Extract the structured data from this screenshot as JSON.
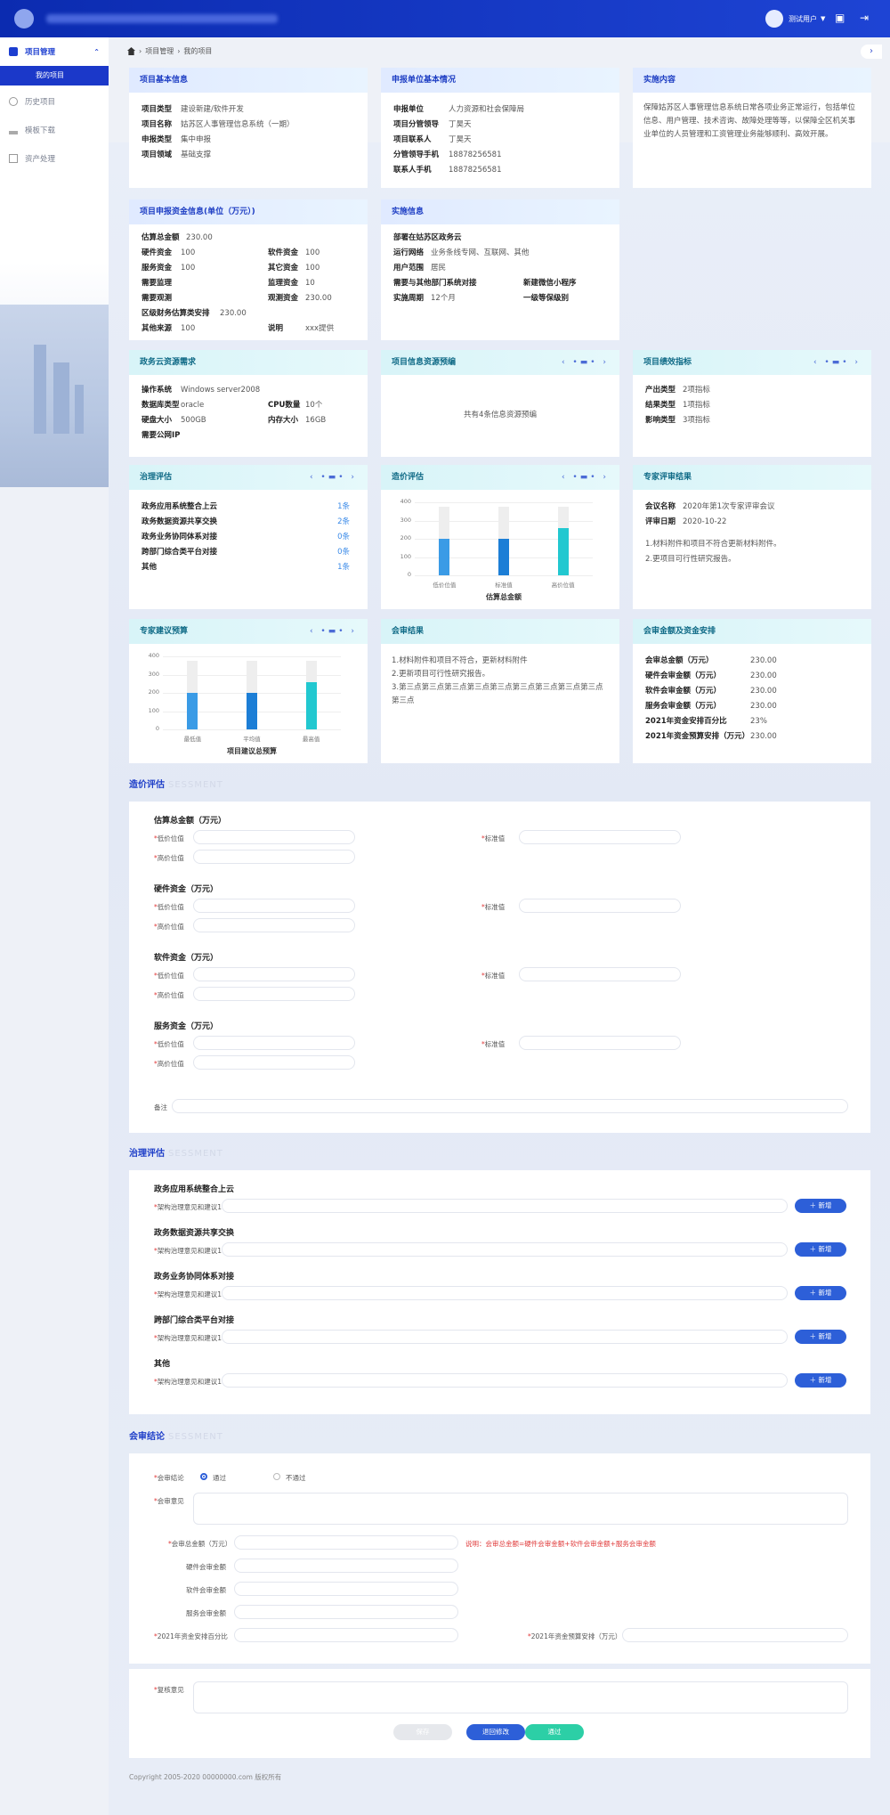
{
  "header": {
    "user": "测试用户"
  },
  "sidebar": {
    "items": [
      {
        "label": "项目管理"
      },
      {
        "label": "我的项目"
      },
      {
        "label": "历史项目"
      },
      {
        "label": "模板下载"
      },
      {
        "label": "资产处理"
      }
    ]
  },
  "breadcrumb": {
    "a": "项目管理",
    "b": "我的项目"
  },
  "basic": {
    "title": "项目基本信息",
    "rows": [
      [
        "项目类型",
        "建设新建/软件开发"
      ],
      [
        "项目名称",
        "姑苏区人事管理信息系统（一期）"
      ],
      [
        "申报类型",
        "集中申报"
      ],
      [
        "项目领域",
        "基础支撑"
      ]
    ]
  },
  "unit": {
    "title": "申报单位基本情况",
    "rows": [
      [
        "申报单位",
        "人力资源和社会保障局"
      ],
      [
        "项目分管领导",
        "丁昊天"
      ],
      [
        "项目联系人",
        "丁昊天"
      ],
      [
        "分管领导手机",
        "18878256581"
      ],
      [
        "联系人手机",
        "18878256581"
      ]
    ]
  },
  "content": {
    "title": "实施内容",
    "text": "保障姑苏区人事管理信息系统日常各项业务正常运行，包括单位信息、用户管理、技术咨询、故障处理等等，以保障全区机关事业单位的人员管理和工资管理业务能够顺利、高效开展。"
  },
  "fund": {
    "title": "项目申报资金信息(单位（万元）)",
    "total_l": "估算总金额",
    "total_v": "230.00",
    "left": [
      [
        "硬件资金",
        "100"
      ],
      [
        "服务资金",
        "100"
      ],
      [
        "需要监理",
        ""
      ],
      [
        "需要观测",
        ""
      ],
      [
        "区级财务估算类安排",
        "230.00"
      ],
      [
        "其他来源",
        "100"
      ]
    ],
    "right": [
      [
        "软件资金",
        "100"
      ],
      [
        "其它资金",
        "100"
      ],
      [
        "监理资金",
        "10"
      ],
      [
        "观测资金",
        "230.00"
      ],
      [
        "",
        ""
      ],
      [
        "说明",
        "xxx提供"
      ]
    ]
  },
  "impl": {
    "title": "实施信息",
    "rows": [
      [
        "部署在姑苏区政务云",
        ""
      ],
      [
        "运行网络",
        "业务条线专网、互联网、其他"
      ],
      [
        "用户范围",
        "居民"
      ],
      [
        "需要与其他部门系统对接",
        ""
      ],
      [
        "实施周期",
        "12个月"
      ]
    ],
    "r1": "新建微信小程序",
    "r2": "一级等保级别"
  },
  "cloud": {
    "title": "政务云资源需求",
    "os_l": "操作系统",
    "os_v": "Windows server2008",
    "db_l": "数据库类型",
    "db_v": "oracle",
    "cpu_l": "CPU数量",
    "cpu_v": "10个",
    "disk_l": "硬盘大小",
    "disk_v": "500GB",
    "mem_l": "内存大小",
    "mem_v": "16GB",
    "ip_l": "需要公网IP"
  },
  "preview": {
    "title": "项目信息资源预编",
    "text": "共有4条信息资源预编"
  },
  "perf": {
    "title": "项目绩效指标",
    "rows": [
      [
        "产出类型",
        "2项指标"
      ],
      [
        "结果类型",
        "1项指标"
      ],
      [
        "影响类型",
        "3项指标"
      ]
    ]
  },
  "gov": {
    "title": "治理评估",
    "rows": [
      [
        "政务应用系统整合上云",
        "1条"
      ],
      [
        "政务数据资源共享交换",
        "2条"
      ],
      [
        "政务业务协同体系对接",
        "0条"
      ],
      [
        "跨部门综合类平台对接",
        "0条"
      ],
      [
        "其他",
        "1条"
      ]
    ]
  },
  "price": {
    "title": "造价评估"
  },
  "expert": {
    "title": "专家评审结果",
    "name_l": "会议名称",
    "name_v": "2020年第1次专家评审会议",
    "date_l": "评审日期",
    "date_v": "2020-10-22",
    "notes": [
      "1.材料附件和项目不符合更新材料附件。",
      "2.更项目可行性研究报告。"
    ]
  },
  "budget": {
    "title": "专家建议预算"
  },
  "review": {
    "title": "会审结果",
    "lines": [
      "1.材料附件和项目不符合，更新材料附件",
      "2.更新项目可行性研究报告。",
      "3.第三点第三点第三点第三点第三点第三点第三点第三点第三点第三点"
    ]
  },
  "amount": {
    "title": "会审金额及资金安排",
    "rows": [
      [
        "会审总金额（万元）",
        "230.00"
      ],
      [
        "硬件会审金额（万元）",
        "230.00"
      ],
      [
        "软件会审金额（万元）",
        "230.00"
      ],
      [
        "服务会审金额（万元）",
        "230.00"
      ],
      [
        "2021年资金安排百分比",
        "23%"
      ],
      [
        "2021年资金预算安排（万元）",
        "230.00"
      ]
    ]
  },
  "chart_data": [
    {
      "type": "bar",
      "title": "估算总金额",
      "categories": [
        "低价位值",
        "标准值",
        "高价位值"
      ],
      "values": [
        200,
        200,
        260
      ],
      "ylim": [
        0,
        400
      ]
    },
    {
      "type": "bar",
      "title": "项目建议总预算",
      "categories": [
        "最低值",
        "平均值",
        "最高值"
      ],
      "values": [
        200,
        200,
        260
      ],
      "ylim": [
        0,
        400
      ]
    }
  ],
  "yticks": [
    "400",
    "300",
    "200",
    "100",
    "0"
  ],
  "form1": {
    "section": "造价评估",
    "ghost": "SESSMENT",
    "groups": [
      "估算总金额（万元）",
      "硬件资金（万元）",
      "软件资金（万元）",
      "服务资金（万元）"
    ],
    "low": "低价位值",
    "std": "标准值",
    "high": "高价位值",
    "remark": "备注"
  },
  "form2": {
    "section": "治理评估",
    "ghost": "SESSMENT",
    "groups": [
      "政务应用系统整合上云",
      "政务数据资源共享交换",
      "政务业务协同体系对接",
      "跨部门综合类平台对接",
      "其他"
    ],
    "field": "架构治理意见和建议1",
    "add": "新增"
  },
  "form3": {
    "section": "会审结论",
    "ghost": "SESSMENT",
    "concl": "会审结论",
    "pass": "通过",
    "fail": "不通过",
    "opinion": "会审意见",
    "total": "会审总金额（万元）",
    "note": "说明：会审总金额=硬件会审金额+软件会审金额+服务会审金额",
    "hw": "硬件会审金额",
    "sw": "软件会审金额",
    "sv": "服务会审金额",
    "pct": "2021年资金安排百分比",
    "bud": "2021年资金预算安排（万元）"
  },
  "form4": {
    "recheck": "复核意见",
    "b1": "保存",
    "b2": "退回修改",
    "b3": "通过"
  },
  "footer": "Copyright 2005-2020 00000000.com 版权所有",
  "colors": {
    "primary": "#1b38c9",
    "bar1": "#3a9be6",
    "bar2": "#1c7ed6",
    "bar3": "#22c8d0"
  }
}
